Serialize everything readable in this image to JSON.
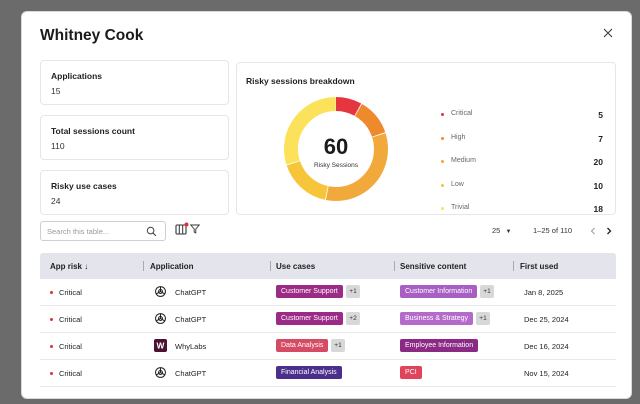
{
  "modal": {
    "title": "Whitney Cook"
  },
  "stats": [
    {
      "label": "Applications",
      "value": "15"
    },
    {
      "label": "Total sessions count",
      "value": "110"
    },
    {
      "label": "Risky use cases",
      "value": "24"
    }
  ],
  "breakdown": {
    "title": "Risky sessions breakdown",
    "center_value": "60",
    "center_label": "Risky Sessions",
    "levels": [
      {
        "name": "Critical",
        "count": "5",
        "value": 5,
        "color": "#e5353e"
      },
      {
        "name": "High",
        "count": "7",
        "value": 7,
        "color": "#ef8a2c"
      },
      {
        "name": "Medium",
        "count": "20",
        "value": 20,
        "color": "#f2a93b"
      },
      {
        "name": "Low",
        "count": "10",
        "value": 10,
        "color": "#f6c53a"
      },
      {
        "name": "Trivial",
        "count": "18",
        "value": 18,
        "color": "#fbe25a"
      }
    ]
  },
  "toolbar": {
    "search_placeholder": "Search this table...",
    "page_size": "25",
    "range": "1–25 of 110"
  },
  "table": {
    "headers": {
      "risk": "App risk ↓",
      "application": "Application",
      "use_cases": "Use cases",
      "sensitive": "Sensitive content",
      "first_used": "First used"
    },
    "rows": [
      {
        "risk": "Critical",
        "app": "ChatGPT",
        "app_icon": "openai-icon",
        "use_case": "Customer Support",
        "use_case_color": "#9b2b86",
        "use_case_extra": "+1",
        "sensitive": "Customer Information",
        "sensitive_color": "#a85fc4",
        "sensitive_extra": "+1",
        "first_used": "Jan 8, 2025"
      },
      {
        "risk": "Critical",
        "app": "ChatGPT",
        "app_icon": "openai-icon",
        "use_case": "Customer Support",
        "use_case_color": "#9b2b86",
        "use_case_extra": "+2",
        "sensitive": "Business & Strategy",
        "sensitive_color": "#b46ac9",
        "sensitive_extra": "+1",
        "first_used": "Dec 25, 2024"
      },
      {
        "risk": "Critical",
        "app": "WhyLabs",
        "app_icon": "whylabs-icon",
        "use_case": "Data Analysis",
        "use_case_color": "#d54b63",
        "use_case_extra": "+1",
        "sensitive": "Employee Information",
        "sensitive_color": "#8a2a84",
        "sensitive_extra": "",
        "first_used": "Dec 16, 2024"
      },
      {
        "risk": "Critical",
        "app": "ChatGPT",
        "app_icon": "openai-icon",
        "use_case": "Financial Analysis",
        "use_case_color": "#4b2f8c",
        "use_case_extra": "",
        "sensitive": "PCI",
        "sensitive_color": "#e0445d",
        "sensitive_extra": "",
        "first_used": "Nov 15, 2024"
      }
    ]
  }
}
